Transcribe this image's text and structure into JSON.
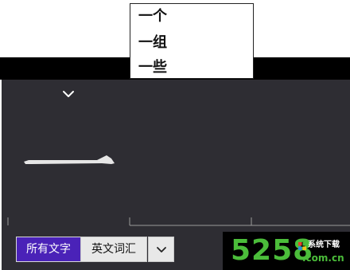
{
  "popup": {
    "items": [
      "一个",
      "一组",
      "一些"
    ]
  },
  "toolbar": {
    "all_text_label": "所有文字",
    "english_words_label": "英文词汇"
  },
  "watermark": {
    "digits": "5258",
    "cn_text": "系统下载",
    "com_text": ".com.cn"
  },
  "colors": {
    "panel_bg": "#2e2d33",
    "accent": "#4a22b8",
    "watermark_green": "#4bbd3a"
  },
  "icons": {
    "chevron_top": "chevron-down-icon",
    "dropdown": "chevron-down-icon",
    "watermark_logo": "windows-logo-icon"
  }
}
